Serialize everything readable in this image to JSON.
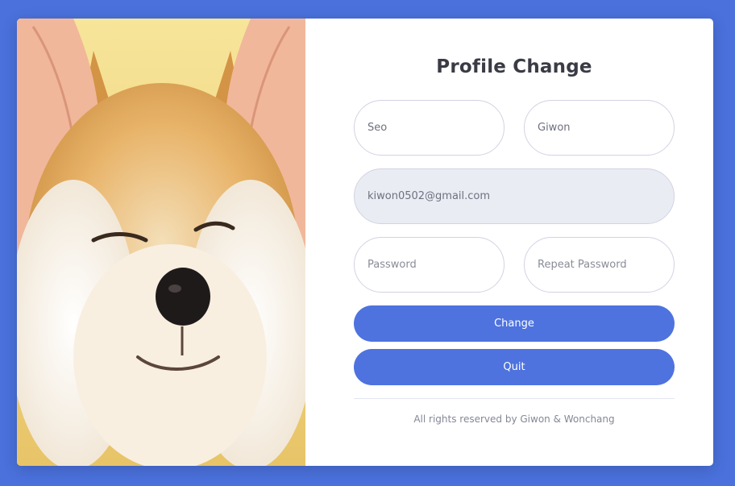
{
  "page": {
    "title": "Profile Change"
  },
  "form": {
    "first_name_value": "Seo",
    "last_name_value": "Giwon",
    "email_value": "kiwon0502@gmail.com",
    "password_placeholder": "Password",
    "repeat_password_placeholder": "Repeat Password"
  },
  "buttons": {
    "change_label": "Change",
    "quit_label": "Quit"
  },
  "footer": {
    "text": "All rights reserved by Giwon & Wonchang"
  },
  "image": {
    "subject": "shiba-inu-dog-photo"
  },
  "colors": {
    "background": "#4a71dc",
    "button": "#4e73df",
    "readonly_field": "#eaecf4",
    "card": "#ffffff"
  }
}
